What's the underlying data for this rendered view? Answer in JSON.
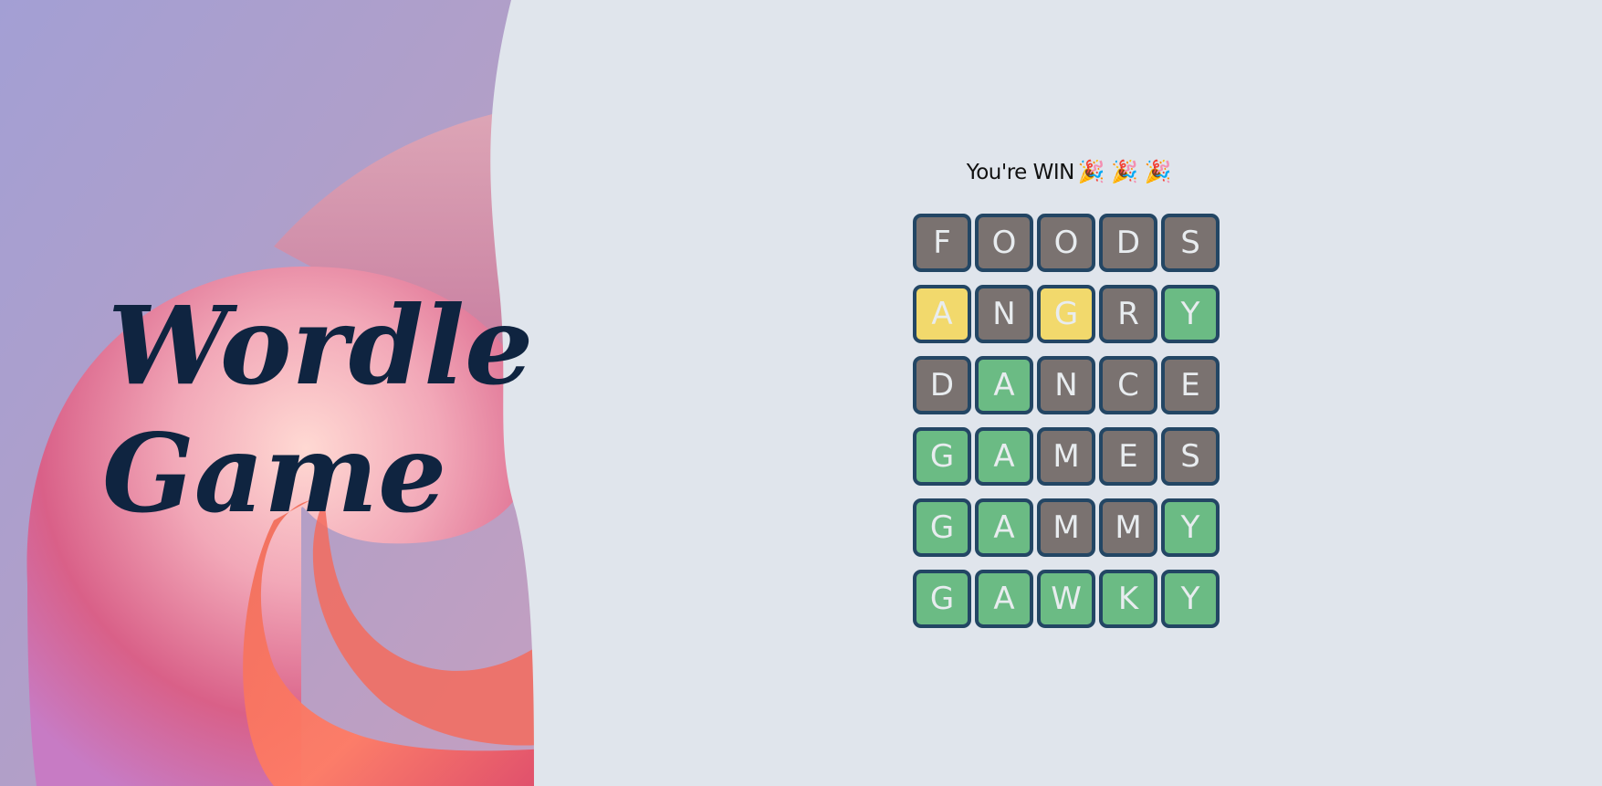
{
  "logo": {
    "line1": "Wordle",
    "line2": "Game"
  },
  "status": {
    "message": "You're WIN",
    "emojis": "🎉 🎉 🎉"
  },
  "colors": {
    "absent": "#7a7270",
    "present": "#f2d96c",
    "correct": "#6bbb84",
    "tile_border": "#234664",
    "background": "#e0e5ec"
  },
  "board": {
    "rows": [
      {
        "letters": [
          "F",
          "O",
          "O",
          "D",
          "S"
        ],
        "states": [
          "absent",
          "absent",
          "absent",
          "absent",
          "absent"
        ]
      },
      {
        "letters": [
          "A",
          "N",
          "G",
          "R",
          "Y"
        ],
        "states": [
          "present",
          "absent",
          "present",
          "absent",
          "correct"
        ]
      },
      {
        "letters": [
          "D",
          "A",
          "N",
          "C",
          "E"
        ],
        "states": [
          "absent",
          "correct",
          "absent",
          "absent",
          "absent"
        ]
      },
      {
        "letters": [
          "G",
          "A",
          "M",
          "E",
          "S"
        ],
        "states": [
          "correct",
          "correct",
          "absent",
          "absent",
          "absent"
        ]
      },
      {
        "letters": [
          "G",
          "A",
          "M",
          "M",
          "Y"
        ],
        "states": [
          "correct",
          "correct",
          "absent",
          "absent",
          "correct"
        ]
      },
      {
        "letters": [
          "G",
          "A",
          "W",
          "K",
          "Y"
        ],
        "states": [
          "correct",
          "correct",
          "correct",
          "correct",
          "correct"
        ]
      }
    ]
  }
}
